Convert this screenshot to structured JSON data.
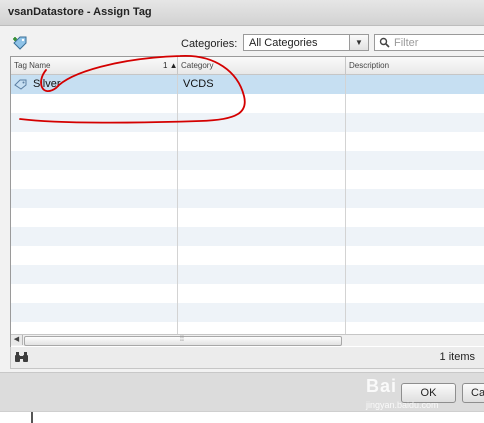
{
  "window": {
    "title": "vsanDatastore - Assign Tag"
  },
  "toolbar": {
    "add_tag_icon": "tag-add-icon",
    "categories_label": "Categories:",
    "categories_selected": "All Categories",
    "filter_placeholder": "Filter"
  },
  "grid": {
    "columns": [
      {
        "label": "Tag Name",
        "sort": "1 ▲"
      },
      {
        "label": "Category"
      },
      {
        "label": "Description"
      }
    ],
    "rows": [
      {
        "tag_name": "Silver",
        "category": "VCDS",
        "description": "",
        "selected": true
      }
    ]
  },
  "footer": {
    "items_count": "1 items"
  },
  "buttons": {
    "ok": "OK",
    "cancel": "Ca"
  },
  "watermark": {
    "main": "Bai",
    "sub": "jingyan.baidu.com"
  },
  "colors": {
    "selected_row": "#c6dff2",
    "annotation": "#d40000"
  }
}
